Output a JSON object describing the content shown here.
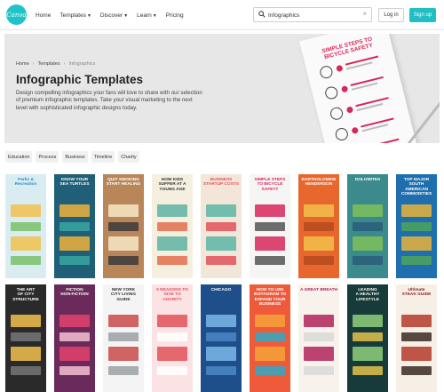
{
  "header": {
    "logo_text": "Canva",
    "nav": [
      {
        "label": "Home",
        "has_menu": false
      },
      {
        "label": "Templates",
        "has_menu": true
      },
      {
        "label": "Discover",
        "has_menu": true
      },
      {
        "label": "Learn",
        "has_menu": true
      },
      {
        "label": "Pricing",
        "has_menu": false
      }
    ],
    "search_value": "Infographics",
    "login_label": "Log in",
    "signup_label": "Sign up",
    "brand_color": "#1fbfc4"
  },
  "hero": {
    "breadcrumb": [
      "Home",
      "Templates",
      "Infographics"
    ],
    "title": "Infographic Templates",
    "description": "Design compelling infographics your fans will love to share with our selection of premium infographic templates. Take your visual marketing to the next level with sophisticated infographic designs today.",
    "preview_heading": "SIMPLE STEPS TO BICYCLE SAFETY"
  },
  "tags": [
    "Education",
    "Process",
    "Business",
    "Timeline",
    "Charity"
  ],
  "templates": [
    {
      "title": "Parks &\nRecreation",
      "bg": "#d8ecf2",
      "fg": "#2a8fc4",
      "accent": "#f2c14e",
      "accent2": "#7bbf6a"
    },
    {
      "title": "KNOW YOUR\nSEA TURTLES",
      "bg": "#1f5f78",
      "fg": "#ffffff",
      "accent": "#f0b13b",
      "accent2": "#3aa6a0"
    },
    {
      "title": "QUIT SMOKING\nSTART HEALING",
      "bg": "#b9865a",
      "fg": "#ffffff",
      "accent": "#f7e7c8",
      "accent2": "#3a3a3a"
    },
    {
      "title": "HOW KIDS\nSUFFER AT A\nYOUNG AGE",
      "bg": "#f4efdf",
      "fg": "#333333",
      "accent": "#5fb3a5",
      "accent2": "#e36f4f"
    },
    {
      "title": "BUSINESS\nSTARTUP COSTS",
      "bg": "#f2e6d9",
      "fg": "#e0525a",
      "accent": "#5cb5a6",
      "accent2": "#e0525a"
    },
    {
      "title": "SIMPLE STEPS\nTO BICYCLE\nSAFETY",
      "bg": "#f5f5f5",
      "fg": "#d6285a",
      "accent": "#d6285a",
      "accent2": "#555555"
    },
    {
      "title": "BARTHOLOMEW\nHENDERSON",
      "bg": "#e8672c",
      "fg": "#ffffff",
      "accent": "#f2c14e",
      "accent2": "#b44a1e"
    },
    {
      "title": "DOLOMITES",
      "bg": "#3b8a8c",
      "fg": "#ffffff",
      "accent": "#7fbf5a",
      "accent2": "#2b5d7a"
    },
    {
      "title": "TOP MAJOR\nSOUTH AMERICAN\nCOMMODITIES",
      "bg": "#1f6fb0",
      "fg": "#ffffff",
      "accent": "#e7b43a",
      "accent2": "#4ea35a"
    },
    {
      "title": "THE ART\nOF CITY\nSTRUCTURE",
      "bg": "#2a2a2a",
      "fg": "#ffffff",
      "accent": "#f2c14e",
      "accent2": "#777777"
    },
    {
      "title": "FICTION\nNON-FICTION",
      "bg": "#6a2b5c",
      "fg": "#ffffff",
      "accent": "#e2426b",
      "accent2": "#f5c0d0"
    },
    {
      "title": "NEW YORK\nCITY LIVING\nGUIDE",
      "bg": "#f4f4f4",
      "fg": "#333333",
      "accent": "#c94a4a",
      "accent2": "#9aa0a6"
    },
    {
      "title": "5 REASONS TO\nGIVE TO CHARITY",
      "bg": "#fbe2e4",
      "fg": "#e0525a",
      "accent": "#e0525a",
      "accent2": "#ffffff"
    },
    {
      "title": "CHICAGO",
      "bg": "#1e4f8a",
      "fg": "#ffffff",
      "accent": "#7ab8e8",
      "accent2": "#4b86c5"
    },
    {
      "title": "HOW TO USE\nINSTAGRAM TO\nEXPAND YOUR\nBUSINESS",
      "bg": "#ef5a3a",
      "fg": "#ffffff",
      "accent": "#f4a23a",
      "accent2": "#2fa9c4"
    },
    {
      "title": "A GREAT BREATH",
      "bg": "#f7f2ec",
      "fg": "#b2245a",
      "accent": "#b2245a",
      "accent2": "#d9d9d9"
    },
    {
      "title": "LEADING\nA HEALTHY\nLIFESTYLE",
      "bg": "#173a3a",
      "fg": "#ffffff",
      "accent": "#8fd07a",
      "accent2": "#e2c34a"
    },
    {
      "title": "Ultimate\nSTEAK GUIDE",
      "bg": "#f6efe6",
      "fg": "#8a2323",
      "accent": "#b43a2a",
      "accent2": "#3a2a22"
    }
  ]
}
